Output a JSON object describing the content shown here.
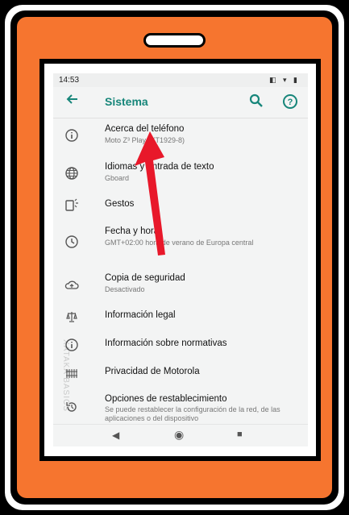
{
  "statusbar": {
    "time": "14:53",
    "icons": "◧ ▾ ▮"
  },
  "appbar": {
    "back_icon": "arrow-back-icon",
    "title": "Sistema",
    "search_icon": "search-icon",
    "help_icon": "help-icon"
  },
  "items": [
    {
      "icon": "info-icon",
      "title": "Acerca del teléfono",
      "subtitle": "Moto Z³ Play (XT1929-8)"
    },
    {
      "icon": "globe-icon",
      "title": "Idiomas y entrada de texto",
      "subtitle": "Gboard"
    },
    {
      "icon": "gestures-icon",
      "title": "Gestos",
      "subtitle": ""
    },
    {
      "icon": "clock-icon",
      "title": "Fecha y hora",
      "subtitle": "GMT+02:00 hora de verano de Europa central"
    },
    {
      "icon": "backup-icon",
      "title": "Copia de seguridad",
      "subtitle": "Desactivado"
    },
    {
      "icon": "balance-icon",
      "title": "Información legal",
      "subtitle": ""
    },
    {
      "icon": "info-icon",
      "title": "Información sobre normativas",
      "subtitle": ""
    },
    {
      "icon": "privacy-icon",
      "title": "Privacidad de Motorola",
      "subtitle": ""
    },
    {
      "icon": "restore-icon",
      "title": "Opciones de restablecimiento",
      "subtitle": "Se puede restablecer la configuración de la red, de las aplicaciones o del dispositivo"
    }
  ],
  "watermark": "XATAKA BASICS",
  "navbar": {
    "back": "◀",
    "home": "◉",
    "recents": "■"
  }
}
